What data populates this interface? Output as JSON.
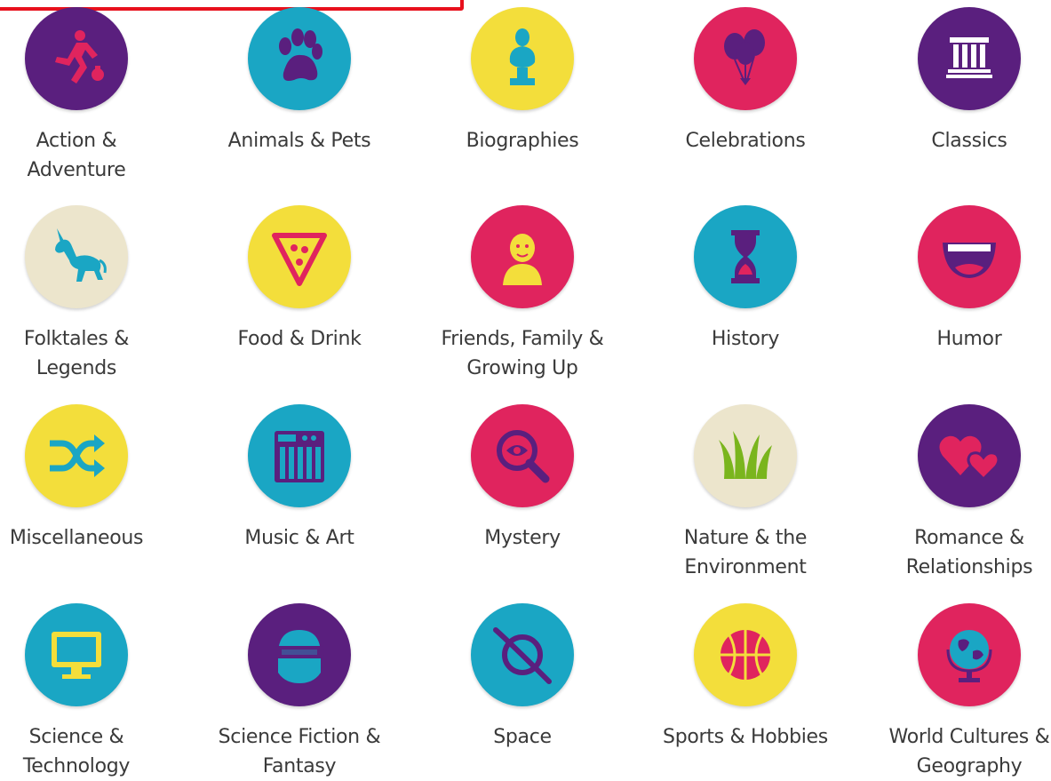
{
  "colors": {
    "purple": "#5a1f7e",
    "teal": "#1aa6c4",
    "yellow": "#f3de3b",
    "pink": "#e0245e",
    "cream": "#ece5cc",
    "highlight": "#e8101c"
  },
  "categories": [
    {
      "label_line1": "Action &",
      "label_line2": "Adventure",
      "icon": "running-person-icon",
      "color": "purple"
    },
    {
      "label_line1": "Animals & Pets",
      "label_line2": "",
      "icon": "paw-print-icon",
      "color": "teal"
    },
    {
      "label_line1": "Biographies",
      "label_line2": "",
      "icon": "bust-statue-icon",
      "color": "yellow"
    },
    {
      "label_line1": "Celebrations",
      "label_line2": "",
      "icon": "balloons-icon",
      "color": "pink"
    },
    {
      "label_line1": "Classics",
      "label_line2": "",
      "icon": "columns-building-icon",
      "color": "purple"
    },
    {
      "label_line1": "Folktales &",
      "label_line2": "Legends",
      "icon": "unicorn-icon",
      "color": "cream"
    },
    {
      "label_line1": "Food & Drink",
      "label_line2": "",
      "icon": "pizza-slice-icon",
      "color": "yellow"
    },
    {
      "label_line1": "Friends, Family &",
      "label_line2": "Growing Up",
      "icon": "child-portrait-icon",
      "color": "pink"
    },
    {
      "label_line1": "History",
      "label_line2": "",
      "icon": "hourglass-icon",
      "color": "teal"
    },
    {
      "label_line1": "Humor",
      "label_line2": "",
      "icon": "laughing-mouth-icon",
      "color": "pink"
    },
    {
      "label_line1": "Miscellaneous",
      "label_line2": "",
      "icon": "shuffle-arrows-icon",
      "color": "yellow"
    },
    {
      "label_line1": "Music & Art",
      "label_line2": "",
      "icon": "keyboard-synth-icon",
      "color": "teal"
    },
    {
      "label_line1": "Mystery",
      "label_line2": "",
      "icon": "magnifying-eye-icon",
      "color": "pink"
    },
    {
      "label_line1": "Nature & the",
      "label_line2": "Environment",
      "icon": "grass-icon",
      "color": "cream"
    },
    {
      "label_line1": "Romance &",
      "label_line2": "Relationships",
      "icon": "hearts-icon",
      "color": "purple"
    },
    {
      "label_line1": "Science &",
      "label_line2": "Technology",
      "icon": "computer-monitor-icon",
      "color": "teal"
    },
    {
      "label_line1": "Science Fiction &",
      "label_line2": "Fantasy",
      "icon": "robot-helmet-icon",
      "color": "purple"
    },
    {
      "label_line1": "Space",
      "label_line2": "",
      "icon": "planet-orbit-icon",
      "color": "teal"
    },
    {
      "label_line1": "Sports & Hobbies",
      "label_line2": "",
      "icon": "basketball-icon",
      "color": "yellow"
    },
    {
      "label_line1": "World Cultures &",
      "label_line2": "Geography",
      "icon": "globe-icon",
      "color": "pink"
    }
  ]
}
